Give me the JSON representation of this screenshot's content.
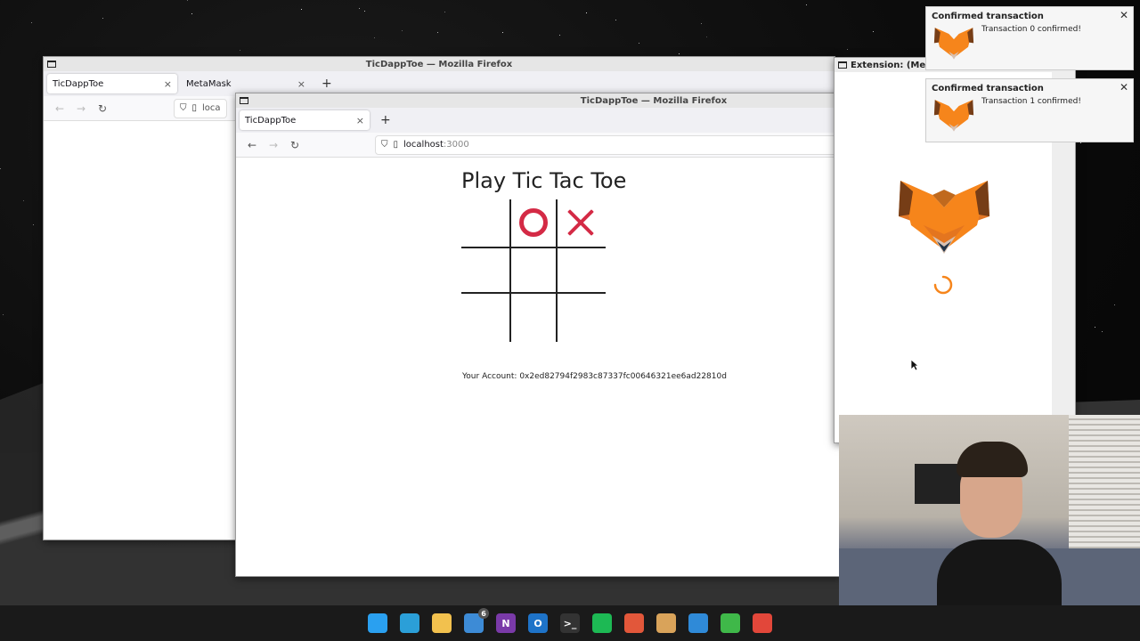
{
  "back_window": {
    "title": "TicDappToe — Mozilla Firefox",
    "tabs": [
      {
        "label": "TicDappToe",
        "close": "×"
      },
      {
        "label": "MetaMask",
        "close": "×"
      }
    ],
    "new_tab": "+",
    "url_partial": "loca"
  },
  "front_window": {
    "title": "TicDappToe — Mozilla Firefox",
    "tabs": [
      {
        "label": "TicDappToe",
        "close": "×"
      }
    ],
    "new_tab": "+",
    "url_host": "localhost",
    "url_port": ":3000"
  },
  "game": {
    "title": "Play Tic Tac Toe",
    "board": [
      "",
      "O",
      "X",
      "",
      "",
      "",
      "",
      "",
      ""
    ],
    "account_label": "Your Account:",
    "account_address": "0x2ed82794f2983c87337fc00646321ee6ad22810d"
  },
  "extension_window": {
    "title": "Extension: (Meta"
  },
  "notifications": [
    {
      "title": "Confirmed transaction",
      "message": "Transaction 0 confirmed!"
    },
    {
      "title": "Confirmed transaction",
      "message": "Transaction 1 confirmed!"
    }
  ],
  "taskbar": {
    "icons": [
      {
        "name": "windows-start-icon",
        "color": "#2aa0f0"
      },
      {
        "name": "edge-icon",
        "color": "#2b9fd8"
      },
      {
        "name": "file-explorer-icon",
        "color": "#f2c14e"
      },
      {
        "name": "todo-icon",
        "color": "#3d8bd6",
        "badge": "6"
      },
      {
        "name": "onenote-icon",
        "color": "#7a3aa8",
        "letter": "N"
      },
      {
        "name": "outlook-icon",
        "color": "#1e73c8",
        "letter": "O"
      },
      {
        "name": "terminal-icon",
        "color": "#333333",
        "letter": ">_"
      },
      {
        "name": "spotify-icon",
        "color": "#1db954"
      },
      {
        "name": "firefox-icon",
        "color": "#e2573a"
      },
      {
        "name": "package-icon",
        "color": "#d9a35a"
      },
      {
        "name": "vscode-icon",
        "color": "#2f8ad8"
      },
      {
        "name": "app-green-icon",
        "color": "#3fb849"
      },
      {
        "name": "app-red-icon",
        "color": "#e2473a"
      }
    ]
  },
  "colors": {
    "mark": "#d42a45",
    "fox_orange": "#e8821e"
  }
}
